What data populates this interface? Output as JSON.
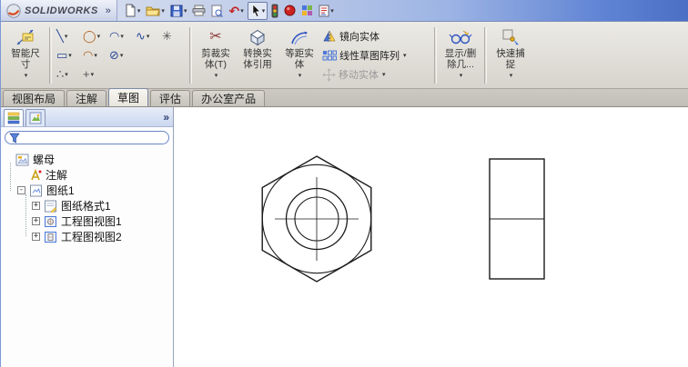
{
  "titlebar": {
    "app_name": "SOLIDWORKS"
  },
  "icons": {
    "dropdown": "▾",
    "overflow": "»",
    "expand": "+",
    "collapse": "-",
    "undo_glyph": "↶",
    "scissors_glyph": "✂",
    "line_glyph": "╲",
    "circle_glyph": "◯",
    "arc_glyph": "◠",
    "spline_glyph": "∿",
    "star_glyph": "✳",
    "rect_glyph": "▭",
    "arc2_glyph": "◠",
    "slot_glyph": "⊘",
    "dots_glyph": "∴",
    "point_glyph": "+"
  },
  "ribbon": {
    "smart_dimension": {
      "line1": "智能尺",
      "line2": "寸"
    },
    "trim": {
      "line1": "剪裁实",
      "line2": "体(T)"
    },
    "convert": {
      "line1": "转换实",
      "line2": "体引用"
    },
    "offset": {
      "line1": "等距实",
      "line2": "体"
    },
    "mirror_label": "镜向实体",
    "linear_pattern_label": "线性草图阵列",
    "move_label": "移动实体",
    "display_delete": {
      "line1": "显示/删",
      "line2": "除几..."
    },
    "quick_snap": {
      "line1": "快速捕",
      "line2": "捉"
    }
  },
  "tabs": {
    "items": [
      {
        "label": "视图布局"
      },
      {
        "label": "注解"
      },
      {
        "label": "草图"
      },
      {
        "label": "评估"
      },
      {
        "label": "办公室产品"
      }
    ],
    "active_index": 2
  },
  "panel": {
    "tree": {
      "items": [
        {
          "label": "螺母"
        },
        {
          "label": "注解"
        },
        {
          "label": "图纸1"
        },
        {
          "label": "图纸格式1"
        },
        {
          "label": "工程图视图1"
        },
        {
          "label": "工程图视图2"
        }
      ]
    }
  },
  "drawing": {
    "views": [
      {
        "name": "front-view"
      },
      {
        "name": "side-view"
      }
    ]
  }
}
